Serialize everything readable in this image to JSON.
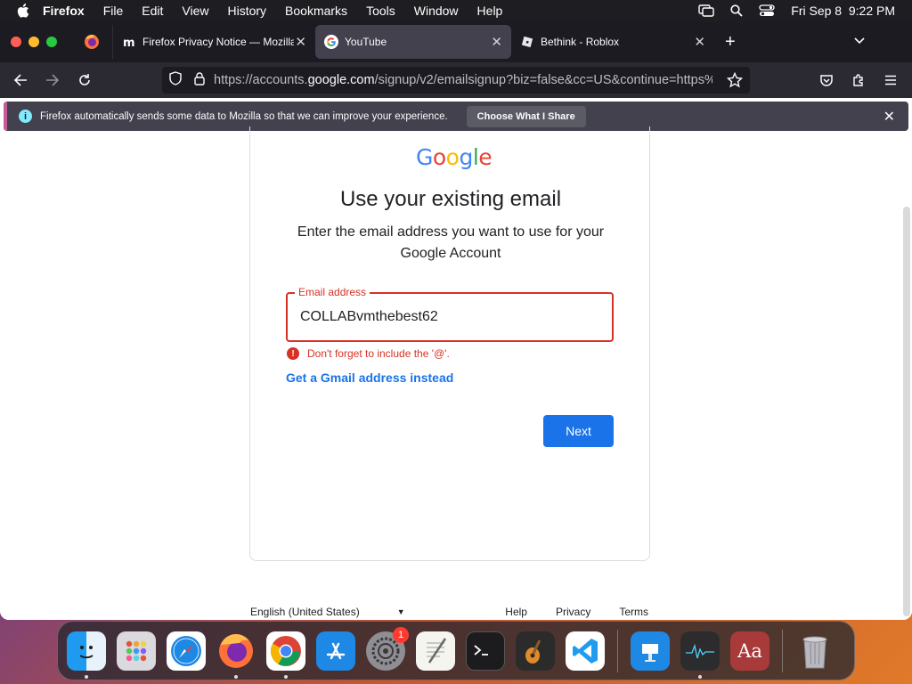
{
  "menubar": {
    "app_name": "Firefox",
    "items": [
      "File",
      "Edit",
      "View",
      "History",
      "Bookmarks",
      "Tools",
      "Window",
      "Help"
    ],
    "datetime": "Fri Sep 8  9:22 PM"
  },
  "tabs": [
    {
      "title": "Firefox Privacy Notice — Mozilla",
      "active": false
    },
    {
      "title": "YouTube",
      "active": true
    },
    {
      "title": "Bethink - Roblox",
      "active": false
    }
  ],
  "urlbar": {
    "prefix": "https://accounts.",
    "domain": "google.com",
    "suffix": "/signup/v2/emailsignup?biz=false&cc=US&continue=https%"
  },
  "notice": {
    "message": "Firefox automatically sends some data to Mozilla so that we can improve your experience.",
    "button": "Choose What I Share"
  },
  "signup": {
    "heading": "Use your existing email",
    "subtext": "Enter the email address you want to use for your Google Account",
    "field_label": "Email address",
    "field_value": "COLLABvmthebest62",
    "error": "Don't forget to include the '@'.",
    "gmail_link": "Get a Gmail address instead",
    "next_button": "Next"
  },
  "footer": {
    "language": "English (United States)",
    "links": [
      "Help",
      "Privacy",
      "Terms"
    ]
  },
  "dock": {
    "settings_badge": "1",
    "dictionary_label": "Aa"
  },
  "colors": {
    "google_blue": "#1a73e8",
    "error_red": "#d93025"
  }
}
